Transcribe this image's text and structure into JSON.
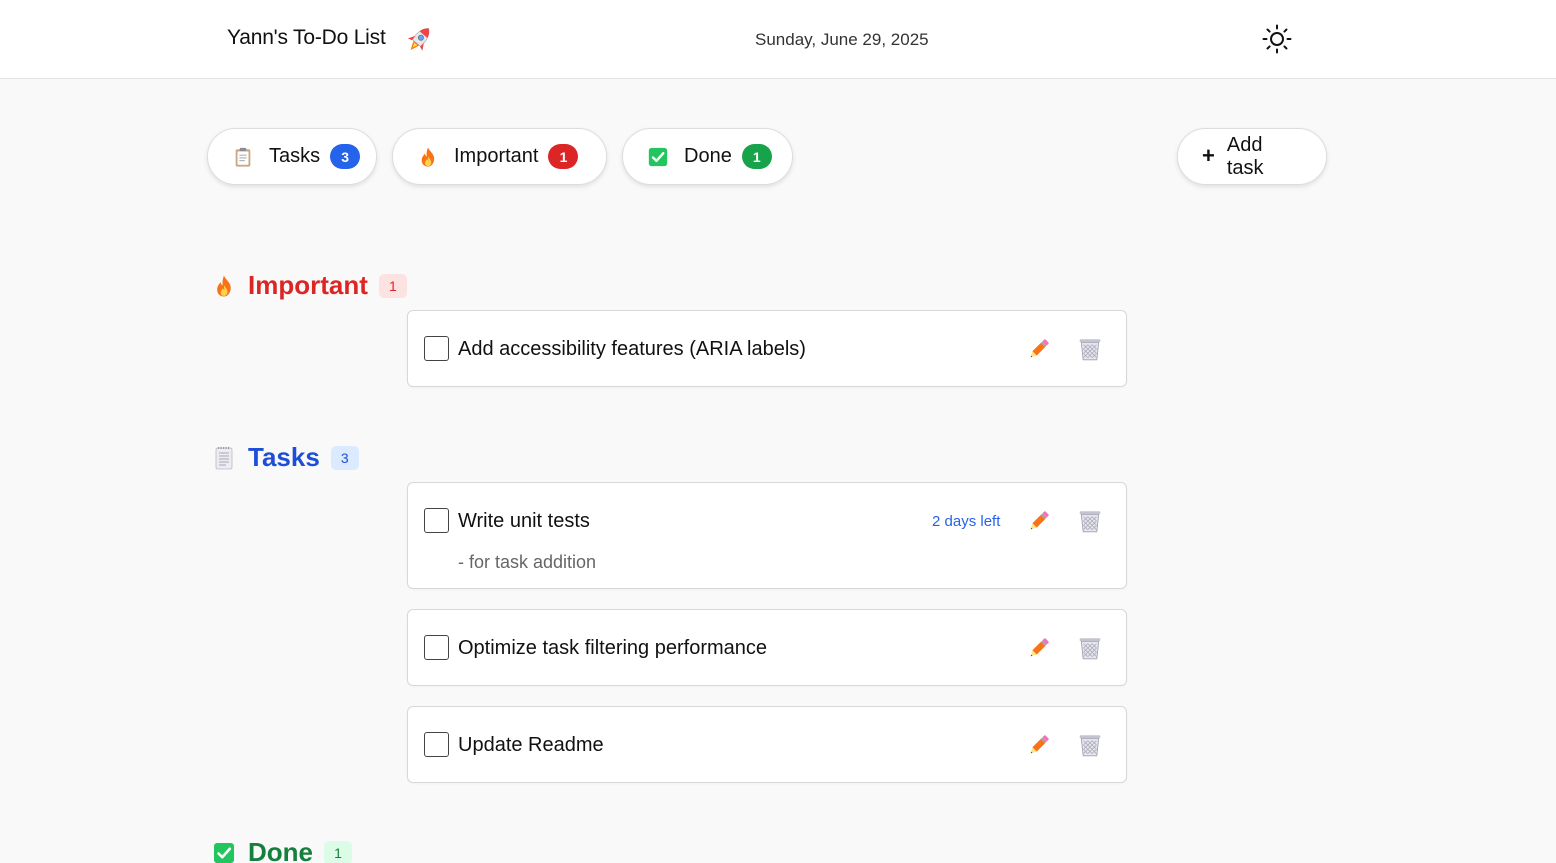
{
  "header": {
    "title": "Yann's To-Do List",
    "date": "Sunday, June 29, 2025"
  },
  "filters": [
    {
      "label": "Tasks",
      "count": "3",
      "icon": "clipboard-icon"
    },
    {
      "label": "Important",
      "count": "1",
      "icon": "fire-icon"
    },
    {
      "label": "Done",
      "count": "1",
      "icon": "check-box-icon"
    }
  ],
  "add_button": {
    "label": "Add task",
    "icon": "+"
  },
  "sections": {
    "important": {
      "title": "Important",
      "count": "1",
      "color": "#dc2626",
      "tasks": [
        {
          "title": "Add accessibility features (ARIA labels)",
          "completed": false
        }
      ]
    },
    "tasks": {
      "title": "Tasks",
      "count": "3",
      "color": "#1d4ed8",
      "tasks": [
        {
          "title": "Write unit tests",
          "note": "- for task addition",
          "due": "2 days left",
          "completed": false
        },
        {
          "title": "Optimize task filtering performance",
          "completed": false
        },
        {
          "title": "Update Readme",
          "completed": false
        }
      ]
    },
    "done": {
      "title": "Done",
      "count": "1",
      "color": "#15803d"
    }
  },
  "colors": {
    "accent_blue": "#2563eb",
    "accent_red": "#dc2626",
    "accent_green": "#16a34a",
    "background": "#f9f9f9"
  }
}
